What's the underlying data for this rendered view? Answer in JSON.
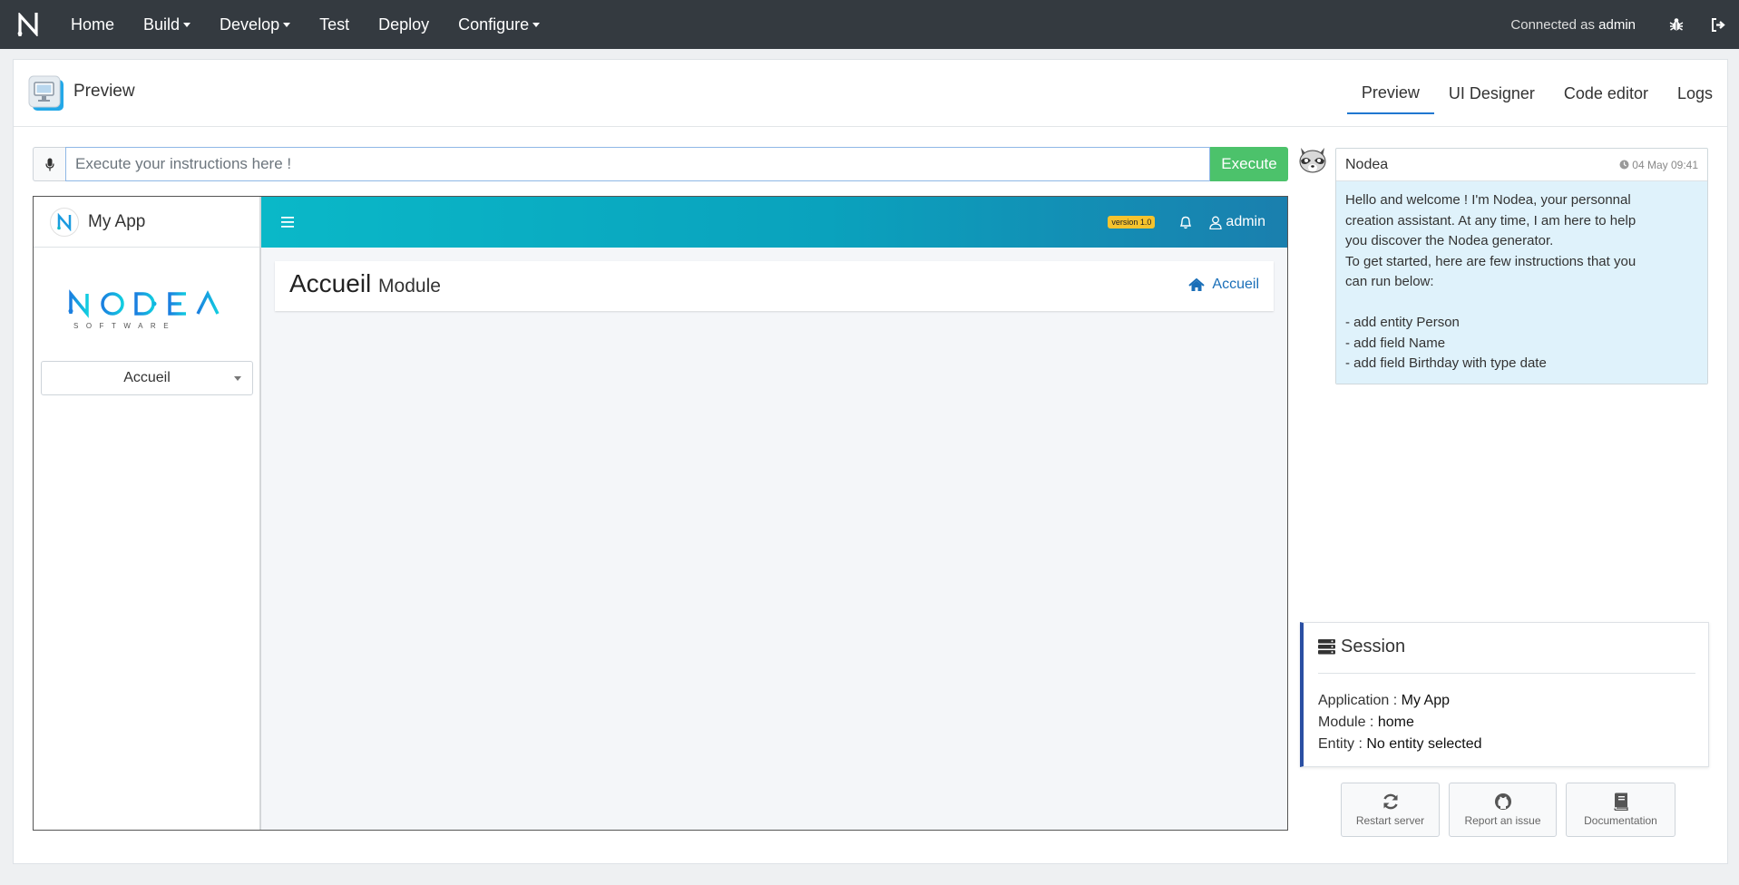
{
  "topnav": {
    "items": [
      {
        "label": "Home",
        "dropdown": false
      },
      {
        "label": "Build",
        "dropdown": true
      },
      {
        "label": "Develop",
        "dropdown": true
      },
      {
        "label": "Test",
        "dropdown": false
      },
      {
        "label": "Deploy",
        "dropdown": false
      },
      {
        "label": "Configure",
        "dropdown": true
      }
    ],
    "connected_prefix": "Connected as",
    "connected_user": "admin"
  },
  "header": {
    "title": "Preview",
    "tabs": [
      "Preview",
      "UI Designer",
      "Code editor",
      "Logs"
    ],
    "active_tab": "Preview"
  },
  "instructions": {
    "placeholder": "Execute your instructions here !",
    "execute_label": "Execute"
  },
  "preview_app": {
    "app_name": "My App",
    "logo_text": "NODEA",
    "logo_sub": "SOFTWARE",
    "module_select": "Accueil",
    "version_badge": "version 1.0",
    "user": "admin",
    "page_title": "Accueil",
    "page_subtitle": "Module",
    "breadcrumb": "Accueil"
  },
  "chat": {
    "author": "Nodea",
    "time": "04 May 09:41",
    "lines": [
      "Hello and welcome ! I'm Nodea, your personnal",
      "creation assistant. At any time, I am here to help",
      "you discover the Nodea generator.",
      "To get started, here are few instructions that you",
      "can run below:",
      "",
      "- add entity Person",
      "- add field Name",
      "- add field Birthday with type date"
    ]
  },
  "session": {
    "title": "Session",
    "application_label": "Application :",
    "application_value": "My App",
    "module_label": "Module :",
    "module_value": "home",
    "entity_label": "Entity :",
    "entity_value": "No entity selected"
  },
  "actions": {
    "restart": "Restart server",
    "report": "Report an issue",
    "docs": "Documentation"
  },
  "colors": {
    "topbar": "#343a40",
    "execute": "#4cc26b",
    "accent": "#1f77d0",
    "session_border": "#2a4fa3"
  }
}
